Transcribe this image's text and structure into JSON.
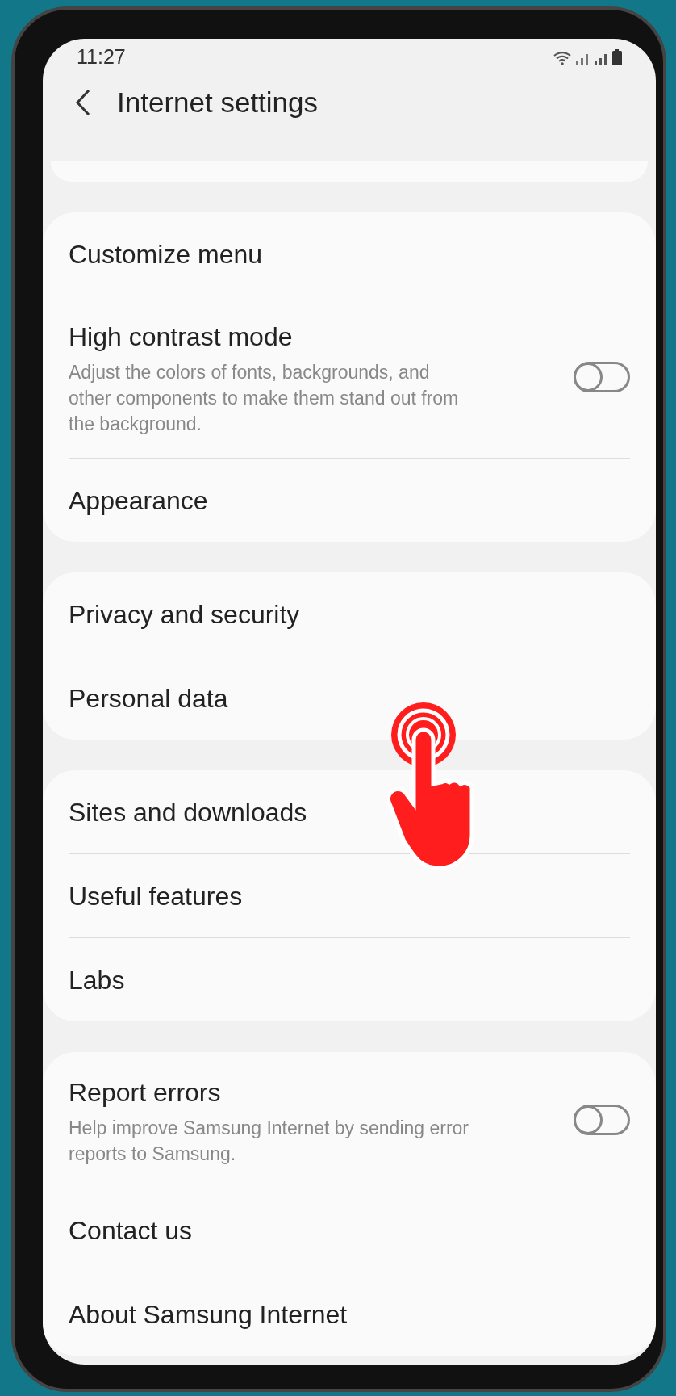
{
  "status_bar": {
    "time": "11:27"
  },
  "header": {
    "title": "Internet settings"
  },
  "sections": [
    {
      "items": [
        {
          "kind": "link",
          "title": "Customize menu"
        },
        {
          "kind": "toggle",
          "title": "High contrast mode",
          "subtitle": "Adjust the colors of fonts, backgrounds, and other components to make them stand out from the background.",
          "on": false
        },
        {
          "kind": "link",
          "title": "Appearance"
        }
      ]
    },
    {
      "items": [
        {
          "kind": "link",
          "title": "Privacy and security"
        },
        {
          "kind": "link",
          "title": "Personal data"
        }
      ]
    },
    {
      "items": [
        {
          "kind": "link",
          "title": "Sites and downloads"
        },
        {
          "kind": "link",
          "title": "Useful features"
        },
        {
          "kind": "link",
          "title": "Labs"
        }
      ]
    },
    {
      "items": [
        {
          "kind": "toggle",
          "title": "Report errors",
          "subtitle": "Help improve Samsung Internet by sending error reports to Samsung.",
          "on": false
        },
        {
          "kind": "link",
          "title": "Contact us"
        },
        {
          "kind": "link",
          "title": "About Samsung Internet"
        }
      ]
    }
  ]
}
